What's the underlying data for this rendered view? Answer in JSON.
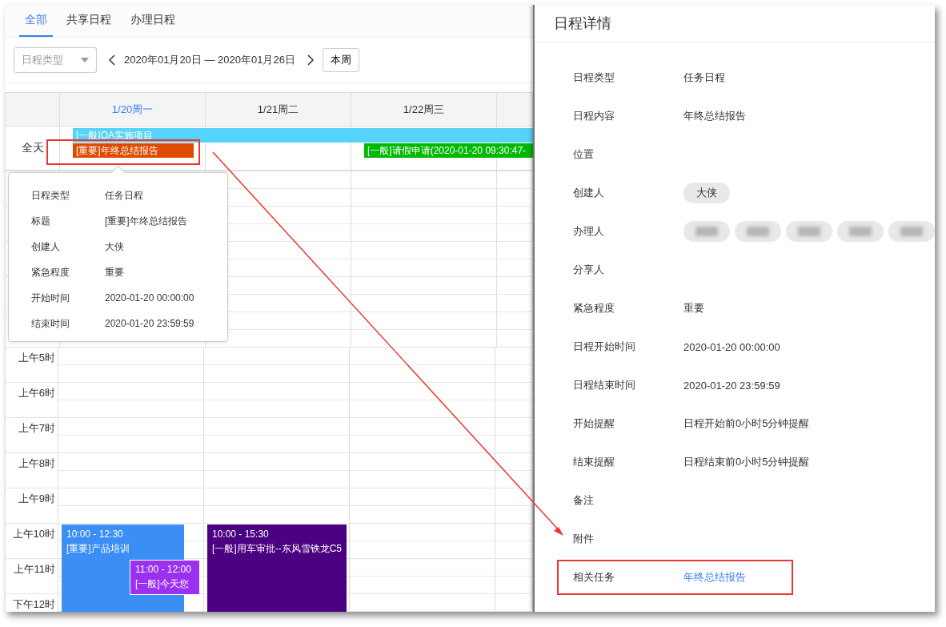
{
  "tabs": [
    {
      "label": "全部",
      "selected": true
    },
    {
      "label": "共享日程",
      "selected": false
    },
    {
      "label": "办理日程",
      "selected": false
    }
  ],
  "toolbar": {
    "type_select": {
      "placeholder": "日程类型"
    },
    "date_range": "2020年01月20日 — 2020年01月26日",
    "week_button": "本周"
  },
  "calendar": {
    "days": [
      {
        "label": "1/20周一",
        "selected": true,
        "all_day_events": [
          {
            "title": "[一般]OA实施项目",
            "color": "#55d3fa",
            "continues": true,
            "highlighted": false
          },
          {
            "title": "[重要]年终总结报告",
            "color": "#e04a00",
            "continues": false,
            "highlighted": true
          }
        ],
        "events": [
          {
            "time": "10:00 - 12:30",
            "title": "[重要]产品培训",
            "color": "#3a8ef6",
            "kind": "full"
          },
          {
            "time": "11:00 - 12:00",
            "title": "[一般]今天您",
            "color": "#9b30f0",
            "kind": "overlap"
          }
        ]
      },
      {
        "label": "1/21周二",
        "selected": false,
        "events": [
          {
            "time": "10:00 - 15:30",
            "title": "[一般]用车审批--东风雪铁龙C5",
            "color": "#4b0082",
            "kind": "full"
          }
        ]
      },
      {
        "label": "1/22周三",
        "selected": false,
        "all_day_events": [
          {
            "title": "[一般]请假申请(2020-01-20 09:30:47-",
            "color": "#00b800",
            "continues": true,
            "highlighted": false
          }
        ]
      }
    ],
    "all_day_label": "全天",
    "hours": [
      "上午5时",
      "上午6时",
      "上午7时",
      "上午8时",
      "上午9时",
      "上午10时",
      "上午11时",
      "下午12时"
    ]
  },
  "popover": {
    "rows": [
      {
        "label": "日程类型",
        "value": "任务日程"
      },
      {
        "label": "标题",
        "value": "[重要]年终总结报告"
      },
      {
        "label": "创建人",
        "value": "大侠"
      },
      {
        "label": "紧急程度",
        "value": "重要"
      },
      {
        "label": "开始时间",
        "value": "2020-01-20 00:00:00"
      },
      {
        "label": "结束时间",
        "value": "2020-01-20 23:59:59"
      }
    ]
  },
  "detail": {
    "title": "日程详情",
    "rows": [
      {
        "label": "日程类型",
        "kind": "text",
        "value": "任务日程"
      },
      {
        "label": "日程内容",
        "kind": "text",
        "value": "年终总结报告"
      },
      {
        "label": "位置",
        "kind": "empty"
      },
      {
        "label": "创建人",
        "kind": "chips",
        "chips": [
          {
            "kind": "name",
            "text": "大侠"
          }
        ]
      },
      {
        "label": "办理人",
        "kind": "chips",
        "chips": [
          {
            "kind": "blurred"
          },
          {
            "kind": "blurred"
          },
          {
            "kind": "blurred"
          },
          {
            "kind": "blurred"
          },
          {
            "kind": "blurred"
          }
        ]
      },
      {
        "label": "分享人",
        "kind": "empty"
      },
      {
        "label": "紧急程度",
        "kind": "text",
        "value": "重要"
      },
      {
        "label": "日程开始时间",
        "kind": "text",
        "value": "2020-01-20 00:00:00"
      },
      {
        "label": "日程结束时间",
        "kind": "text",
        "value": "2020-01-20 23:59:59"
      },
      {
        "label": "开始提醒",
        "kind": "text",
        "value": "日程开始前0小时5分钟提醒"
      },
      {
        "label": "结束提醒",
        "kind": "text",
        "value": "日程结束前0小时5分钟提醒"
      },
      {
        "label": "备注",
        "kind": "empty"
      },
      {
        "label": "附件",
        "kind": "empty"
      },
      {
        "label": "相关任务",
        "kind": "link",
        "value": "年终总结报告",
        "highlighted": true
      }
    ]
  }
}
